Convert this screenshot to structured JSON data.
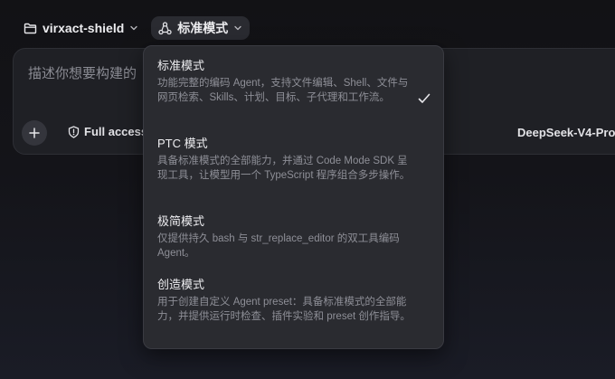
{
  "topbar": {
    "project_name": "virxact-shield",
    "mode_label": "标准模式"
  },
  "composer": {
    "placeholder": "描述你想要构建的",
    "access_label": "Full access",
    "model_label": "DeepSeek-V4-Pro"
  },
  "menu": {
    "items": [
      {
        "title": "标准模式",
        "desc": "功能完整的编码 Agent，支持文件编辑、Shell、文件与网页检索、Skills、计划、目标、子代理和工作流。",
        "selected": true
      },
      {
        "title": "PTC 模式",
        "desc": "具备标准模式的全部能力，并通过 Code Mode SDK 呈现工具，让模型用一个 TypeScript 程序组合多步操作。",
        "selected": false
      },
      {
        "title": "极简模式",
        "desc": "仅提供持久 bash 与 str_replace_editor 的双工具编码 Agent。",
        "selected": false
      },
      {
        "title": "创造模式",
        "desc": "用于创建自定义 Agent preset：具备标准模式的全部能力，并提供运行时检查、插件实验和 preset 创作指导。",
        "selected": false
      }
    ]
  },
  "colors": {
    "background": "#141419",
    "card": "#1f2025",
    "menu": "#2a2b30",
    "text_primary": "#ededf0",
    "text_secondary": "#8e8f97"
  }
}
